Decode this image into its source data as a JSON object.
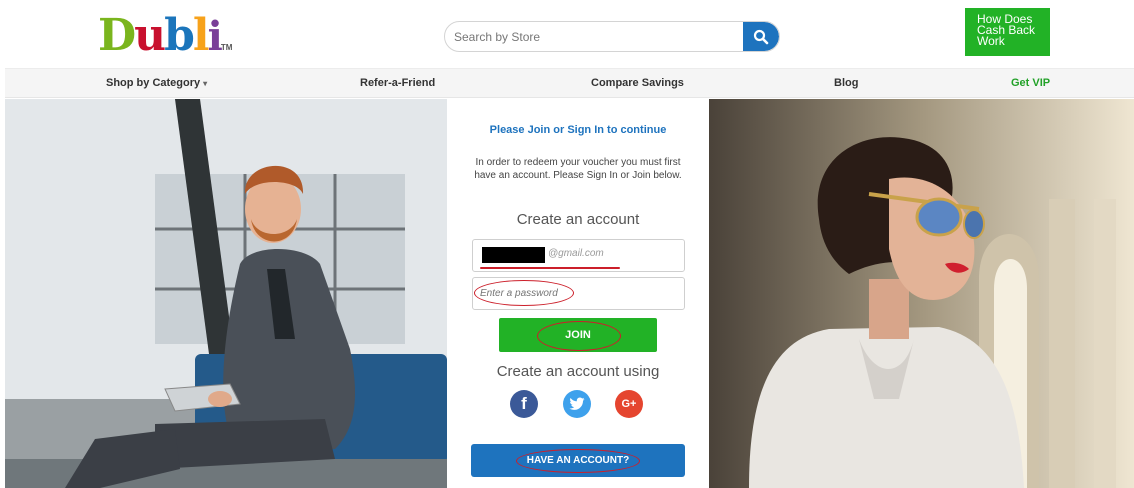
{
  "header": {
    "logo_text": [
      "D",
      "u",
      "b",
      "l",
      "i"
    ],
    "logo_tm": "TM",
    "search_placeholder": "Search by Store",
    "how_button_label": "How Does Cash Back Work"
  },
  "nav": {
    "items": [
      {
        "label": "Shop by Category",
        "has_dropdown": true
      },
      {
        "label": "Refer-a-Friend"
      },
      {
        "label": "Compare Savings"
      },
      {
        "label": "Blog"
      },
      {
        "label": "Get VIP"
      }
    ],
    "dropdown_caret": "▾"
  },
  "form": {
    "title": "Please Join or Sign In to continue",
    "description": "In order to redeem your voucher you must first have an account. Please Sign In or Join below.",
    "create_heading": "Create an account",
    "email_domain": "@gmail.com",
    "password_placeholder": "Enter a password",
    "join_label": "JOIN",
    "create_using": "Create an account using",
    "social": {
      "facebook": "f",
      "google": "G+"
    },
    "have_account_label": "HAVE AN ACCOUNT?"
  },
  "colors": {
    "brand_blue": "#1e73be",
    "brand_green": "#22b226",
    "annotation_red": "#cc1f2a"
  },
  "icons": [
    "search-icon",
    "facebook-icon",
    "twitter-icon",
    "google-plus-icon"
  ]
}
